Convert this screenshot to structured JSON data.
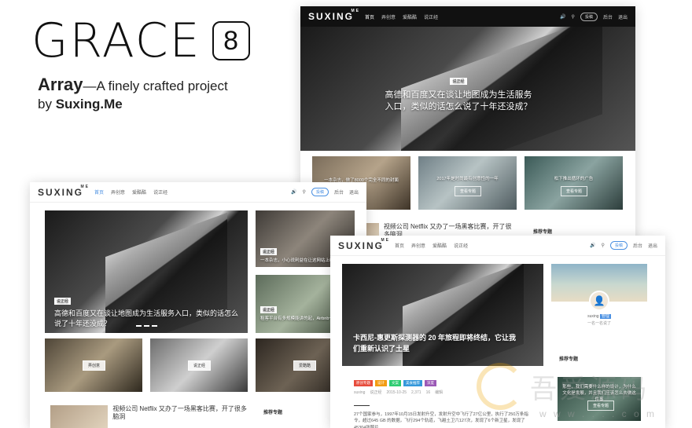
{
  "hero": {
    "brand": "GRACE",
    "version": "8",
    "array_word": "Array",
    "tagline_rest": "—A finely crafted project",
    "by": "by",
    "author": "Suxing.Me"
  },
  "site": {
    "logo": "SUXING",
    "logo_sup": "ME",
    "menu": [
      "首页",
      "弄创意",
      "爱酷酷",
      "说正经"
    ],
    "submit": "投稿",
    "login": "后台",
    "logout": "退出"
  },
  "frame_a": {
    "hero_tag": "说正经",
    "hero_title_1": "高德和百度又在谈让地图成为生活服务",
    "hero_title_2": "入口，类似的话怎么说了十年还没成？",
    "cards": [
      {
        "title": "一本杂志，做了8000个完全不同的封面"
      },
      {
        "title": "2017年是时尚最有创意性的一年",
        "btn": "查看专题"
      },
      {
        "title": "松下推出循环的广告",
        "btn": "查看专题"
      }
    ],
    "list_title": "视频公司 Netflix 又办了一场黑客比赛，开了很多脑洞",
    "sidebar_title": "推荐专题"
  },
  "frame_b": {
    "hero_tag": "说正经",
    "hero_title": "高德和百度又在谈让地图成为生活服务入口，类似的话怎么说了十年还没成？",
    "side_cards": [
      {
        "tag": "说正经",
        "title": "一本杂志，小心说利益在让这网站上线"
      },
      {
        "tag": "说正经",
        "title": "租客平台有多规模能讲的起，Airbnb一样成功?"
      }
    ],
    "bottom_cards": [
      "弄创意",
      "说正经",
      "爱酷酷"
    ],
    "list_title": "视频公司 Netflix 又办了一场黑客比赛，开了很多脑洞",
    "sidebar_title": "推荐专题"
  },
  "frame_c": {
    "hero_title_1": "卡西尼-惠更斯探测器的 20 年旅程即将终结，它让我",
    "hero_title_2": "们重新认识了土星",
    "tags": [
      "原创专题",
      "设计",
      "文案",
      "美食推荐",
      "深度"
    ],
    "meta": [
      "suxing",
      "说正经",
      "2015-10-25",
      "2,371",
      "16",
      "编辑"
    ],
    "body": "27个国家参与，1997年10月15日发射升空，发射升空中飞行了27亿公里，执行了250万条指令，超过645 GB 的数据，飞行294个轨道，飞越土卫六127次，发现了6个新卫星，发现了45304张照片...",
    "profile_name": "suxing",
    "profile_badge": "管理",
    "profile_bio": "一名一名说了",
    "sidebar_title": "推荐专题",
    "promo_text": "那些，我们需要什么样的设计，为什么文化是发展，并且我们应该怎么去做这件事",
    "promo_btn": "查看专题"
  },
  "watermark": {
    "text": "吾爱源码",
    "url": "w w w . . . . c o m"
  }
}
